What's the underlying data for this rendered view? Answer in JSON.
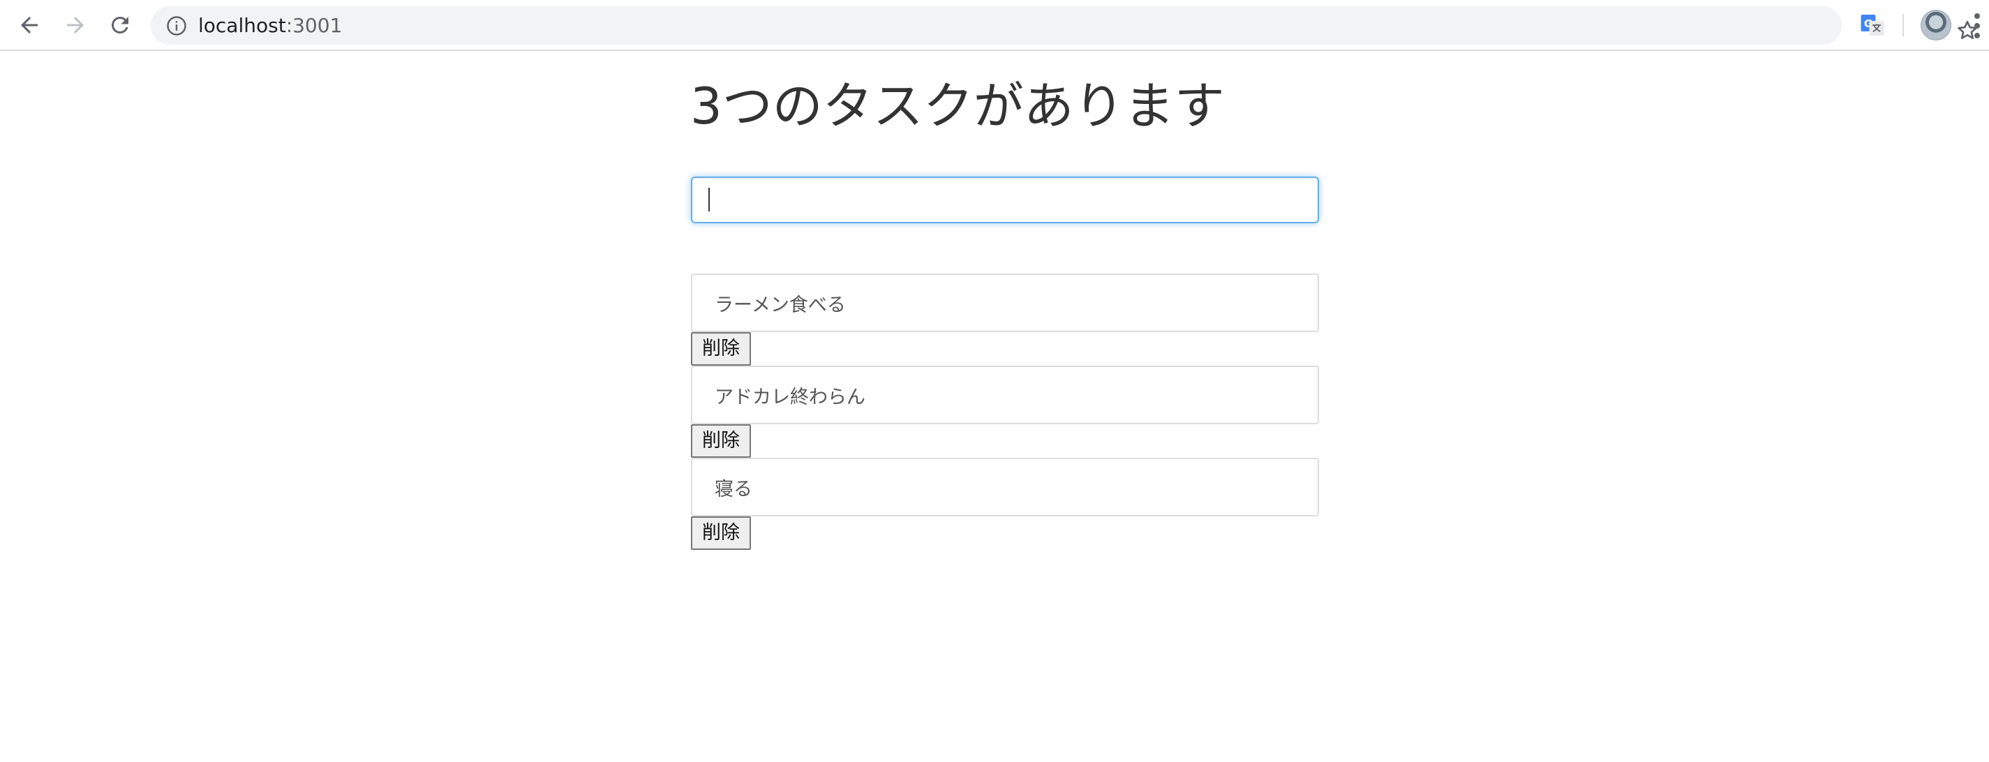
{
  "browser": {
    "url_host": "localhost",
    "url_port": ":3001",
    "icons": {
      "back": "arrow-left-icon",
      "forward": "arrow-right-icon",
      "reload": "reload-icon",
      "site_info": "info-icon",
      "bookmark": "star-icon",
      "translate": "google-translate-icon",
      "profile": "avatar",
      "menu": "more-vert-icon"
    }
  },
  "page": {
    "title": "3つのタスクがあります",
    "input_value": ""
  },
  "tasks": [
    {
      "text": "ラーメン食べる",
      "delete_label": "削除"
    },
    {
      "text": "アドカレ終わらん",
      "delete_label": "削除"
    },
    {
      "text": "寝る",
      "delete_label": "削除"
    }
  ],
  "colors": {
    "focus_border": "#66afe9",
    "title_text": "#333333",
    "task_text": "#555555"
  }
}
